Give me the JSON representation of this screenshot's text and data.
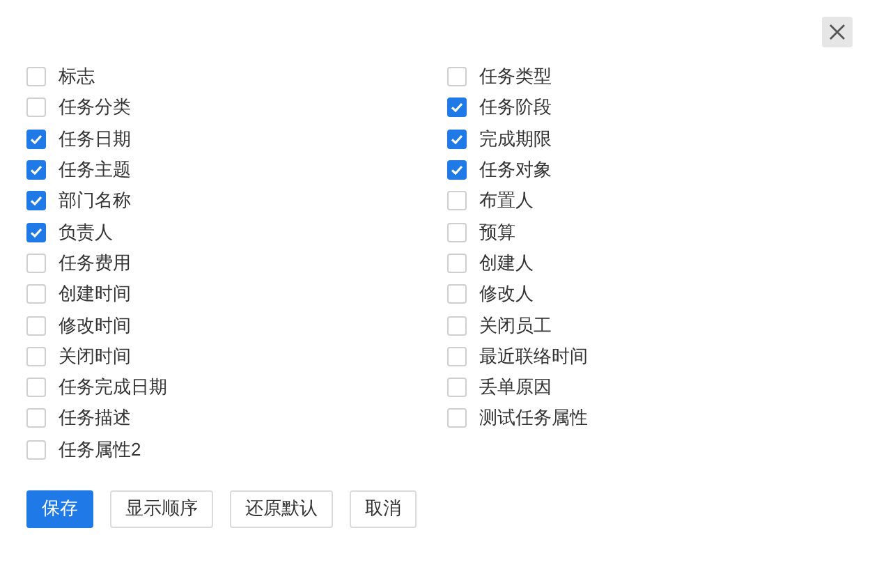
{
  "columns": [
    {
      "items": [
        {
          "label": "标志",
          "checked": false
        },
        {
          "label": "任务分类",
          "checked": false
        },
        {
          "label": "任务日期",
          "checked": true
        },
        {
          "label": "任务主题",
          "checked": true
        },
        {
          "label": "部门名称",
          "checked": true
        },
        {
          "label": "负责人",
          "checked": true
        },
        {
          "label": "任务费用",
          "checked": false
        },
        {
          "label": "创建时间",
          "checked": false
        },
        {
          "label": "修改时间",
          "checked": false
        },
        {
          "label": "关闭时间",
          "checked": false
        },
        {
          "label": "任务完成日期",
          "checked": false
        },
        {
          "label": "任务描述",
          "checked": false
        },
        {
          "label": "任务属性2",
          "checked": false
        }
      ]
    },
    {
      "items": [
        {
          "label": "任务类型",
          "checked": false
        },
        {
          "label": "任务阶段",
          "checked": true
        },
        {
          "label": "完成期限",
          "checked": true
        },
        {
          "label": "任务对象",
          "checked": true
        },
        {
          "label": "布置人",
          "checked": false
        },
        {
          "label": "预算",
          "checked": false
        },
        {
          "label": "创建人",
          "checked": false
        },
        {
          "label": "修改人",
          "checked": false
        },
        {
          "label": "关闭员工",
          "checked": false
        },
        {
          "label": "最近联络时间",
          "checked": false
        },
        {
          "label": "丢单原因",
          "checked": false
        },
        {
          "label": "测试任务属性",
          "checked": false
        }
      ]
    }
  ],
  "buttons": [
    {
      "label": "保存",
      "kind": "primary"
    },
    {
      "label": "显示顺序",
      "kind": "default"
    },
    {
      "label": "还原默认",
      "kind": "default"
    },
    {
      "label": "取消",
      "kind": "default"
    }
  ]
}
